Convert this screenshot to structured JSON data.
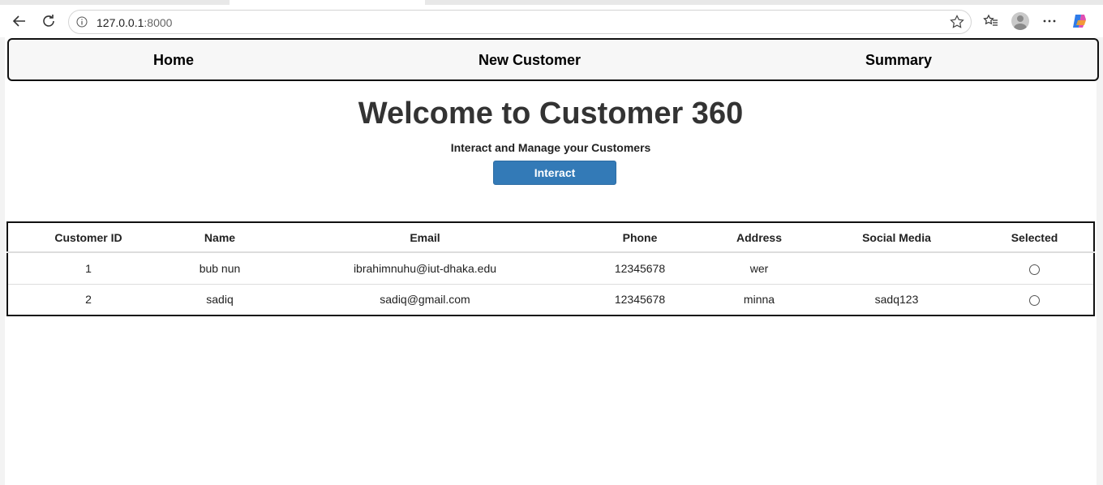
{
  "browser": {
    "url_host": "127.0.0.1",
    "url_port": ":8000"
  },
  "nav": {
    "home": "Home",
    "new_customer": "New Customer",
    "summary": "Summary"
  },
  "hero": {
    "title": "Welcome to Customer 360",
    "subtitle": "Interact and Manage your Customers",
    "button_label": "Interact"
  },
  "table": {
    "headers": [
      "Customer ID",
      "Name",
      "Email",
      "Phone",
      "Address",
      "Social Media",
      "Selected"
    ],
    "rows": [
      {
        "id": "1",
        "name": "bub nun",
        "email": "ibrahimnuhu@iut-dhaka.edu",
        "phone": "12345678",
        "address": "wer",
        "social": "",
        "selected": false
      },
      {
        "id": "2",
        "name": "sadiq",
        "email": "sadiq@gmail.com",
        "phone": "12345678",
        "address": "minna",
        "social": "sadq123",
        "selected": false
      }
    ]
  },
  "icons": {
    "back": "back-arrow-icon",
    "reload": "reload-icon",
    "info": "site-info-icon",
    "favorite": "star-icon",
    "favorites_list": "favorites-icon",
    "profile": "profile-avatar-icon",
    "menu": "more-menu-icon",
    "copilot": "copilot-icon"
  }
}
